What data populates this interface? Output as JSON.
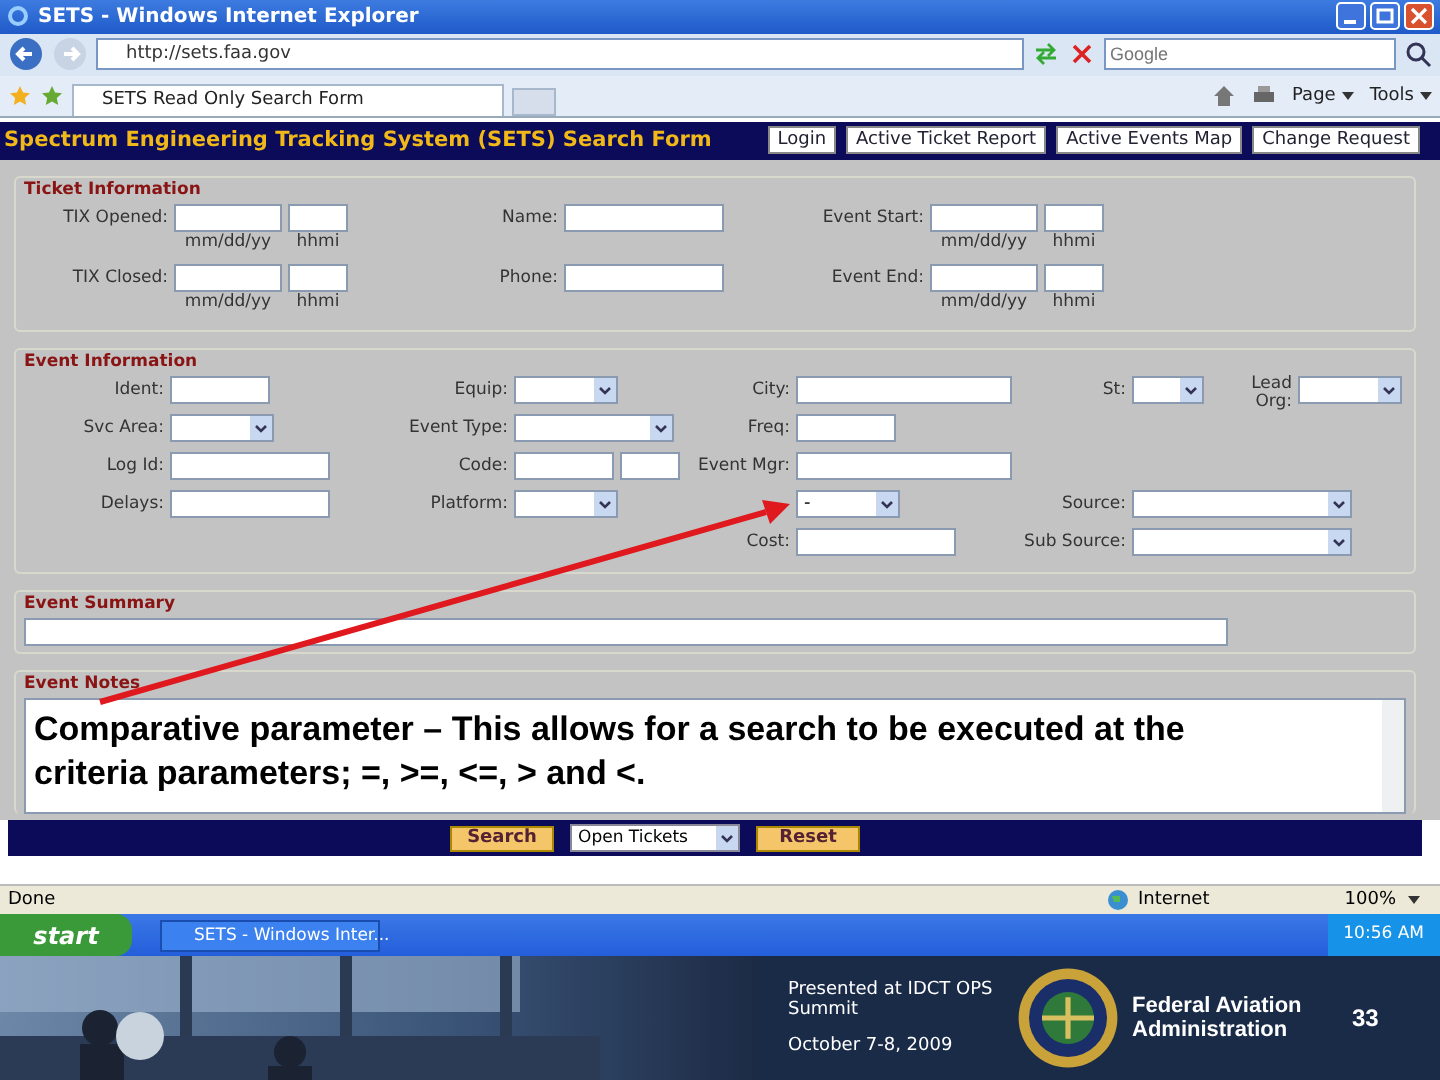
{
  "window": {
    "title": "SETS - Windows Internet Explorer"
  },
  "address_bar": {
    "url": "http://sets.faa.gov"
  },
  "search_box": {
    "placeholder": "Google"
  },
  "tabs": [
    {
      "label": "SETS Read Only Search Form",
      "selected": true
    }
  ],
  "command_bar": [
    "Page",
    "Tools"
  ],
  "app": {
    "title": "Spectrum Engineering Tracking System (SETS) Search Form",
    "nav_buttons": [
      "Login",
      "Active Ticket Report",
      "Active Events Map",
      "Change Request"
    ]
  },
  "ticket_information": {
    "title": "Ticket Information",
    "rows": [
      [
        {
          "items": [
            {
              "label": "TIX Opened:",
              "fields": [
                {
                  "kind": "date",
                  "caption": "mm/dd/yy"
                },
                {
                  "kind": "time",
                  "caption": "hhmi"
                }
              ]
            }
          ]
        },
        {
          "items": [
            {
              "label": "Name:",
              "fields": [
                {
                  "kind": "input"
                }
              ]
            }
          ]
        },
        {
          "items": [
            {
              "label": "Event Start:",
              "fields": [
                {
                  "kind": "date",
                  "caption": "mm/dd/yy"
                },
                {
                  "kind": "time",
                  "caption": "hhmi"
                }
              ]
            }
          ]
        }
      ],
      [
        {
          "items": [
            {
              "label": "TIX Closed:",
              "fields": [
                {
                  "kind": "date",
                  "caption": "mm/dd/yy"
                },
                {
                  "kind": "time",
                  "caption": "hhmi"
                }
              ]
            }
          ]
        },
        {
          "items": [
            {
              "label": "Phone:",
              "fields": [
                {
                  "kind": "input"
                }
              ]
            }
          ]
        },
        {
          "items": [
            {
              "label": "Event End:",
              "fields": [
                {
                  "kind": "date",
                  "caption": "mm/dd/yy"
                },
                {
                  "kind": "time",
                  "caption": "hhmi"
                }
              ]
            }
          ]
        }
      ]
    ]
  },
  "event_information": {
    "title": "Event Information",
    "rows": [
      [
        {
          "items": [
            {
              "label": "Ident:",
              "fields": [
                {
                  "kind": "short-input"
                }
              ]
            }
          ]
        },
        {
          "items": [
            {
              "label": "Equip:",
              "fields": [
                {
                  "kind": "select"
                }
              ]
            }
          ]
        },
        {
          "items": [
            {
              "label": "City:",
              "fields": [
                {
                  "kind": "long-input"
                }
              ]
            }
          ]
        },
        {
          "items": [
            {
              "label": "St:",
              "fields": [
                {
                  "kind": "short-select"
                }
              ]
            },
            {
              "label": "Lead Org:",
              "fields": [
                {
                  "kind": "select"
                }
              ]
            }
          ]
        }
      ],
      [
        {
          "items": [
            {
              "label": "Svc Area:",
              "fields": [
                {
                  "kind": "select"
                }
              ]
            }
          ]
        },
        {
          "items": [
            {
              "label": "Event Type:",
              "fields": [
                {
                  "kind": "wide-select"
                }
              ]
            }
          ]
        },
        {
          "items": [
            {
              "label": "Freq:",
              "fields": [
                {
                  "kind": "short-input"
                }
              ]
            }
          ]
        },
        null
      ],
      [
        {
          "items": [
            {
              "label": "Log Id:",
              "fields": [
                {
                  "kind": "input"
                }
              ]
            }
          ]
        },
        {
          "items": [
            {
              "label": "Code:",
              "fields": [
                {
                  "kind": "short-input"
                },
                {
                  "kind": "time"
                }
              ]
            }
          ]
        },
        {
          "items": [
            {
              "label": "Event Mgr:",
              "fields": [
                {
                  "kind": "long-input"
                }
              ]
            }
          ]
        },
        null
      ],
      [
        {
          "items": [
            {
              "label": "Delays:",
              "fields": [
                {
                  "kind": "input"
                }
              ]
            }
          ]
        },
        {
          "items": [
            {
              "label": "Platform:",
              "fields": [
                {
                  "kind": "select"
                }
              ]
            }
          ]
        },
        {
          "items": [
            {
              "fields": [
                {
                  "kind": "select",
                  "value": "-"
                }
              ]
            }
          ]
        },
        {
          "items": [
            {
              "label": "Source:",
              "fields": [
                {
                  "kind": "long-select"
                }
              ]
            }
          ]
        }
      ],
      [
        null,
        null,
        {
          "items": [
            {
              "label": "Cost:",
              "fields": [
                {
                  "kind": "input"
                }
              ]
            }
          ]
        },
        {
          "items": [
            {
              "label": "Sub Source:",
              "fields": [
                {
                  "kind": "long-select"
                }
              ]
            }
          ]
        }
      ]
    ]
  },
  "event_summary": {
    "title": "Event Summary"
  },
  "event_notes": {
    "title": "Event Notes",
    "value": "Comparative parameter – This allows for a search to be executed at the criteria parameters; =, >=, <=, > and <."
  },
  "form_actions": {
    "search_button": "Search",
    "filter_select": "Open Tickets",
    "reset_button": "Reset"
  },
  "status_bar": {
    "status": "Done",
    "zone": "Internet",
    "zoom": "100%"
  },
  "taskbar": {
    "start": "start",
    "items": [
      "SETS - Windows Inter..."
    ],
    "clock": "10:56 AM"
  },
  "slide_footer": {
    "presented": "Presented at IDCT OPS Summit",
    "date": "October 7-8, 2009",
    "agency": "Federal Aviation Administration",
    "page": "33"
  }
}
